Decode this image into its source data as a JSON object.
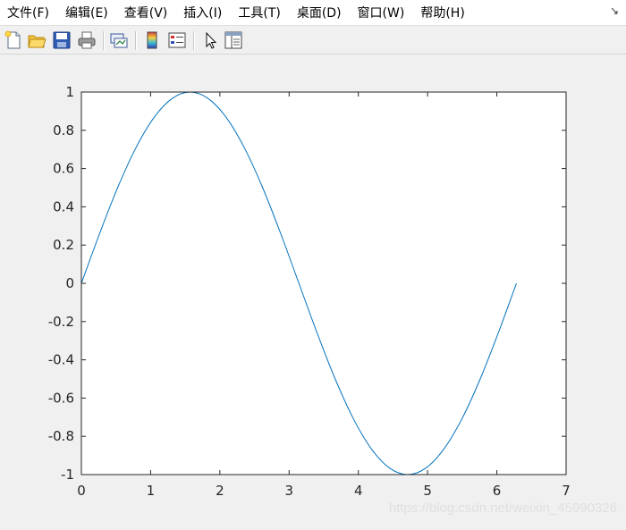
{
  "menu": {
    "items": [
      {
        "label": "文件(F)"
      },
      {
        "label": "编辑(E)"
      },
      {
        "label": "查看(V)"
      },
      {
        "label": "插入(I)"
      },
      {
        "label": "工具(T)"
      },
      {
        "label": "桌面(D)"
      },
      {
        "label": "窗口(W)"
      },
      {
        "label": "帮助(H)"
      }
    ],
    "dock_arrow": "↘"
  },
  "toolbar": {
    "buttons": [
      {
        "icon": "new-figure-icon"
      },
      {
        "icon": "open-file-icon"
      },
      {
        "icon": "save-icon"
      },
      {
        "icon": "print-icon"
      },
      {
        "icon": "link-plot-icon"
      },
      {
        "icon": "insert-colorbar-icon"
      },
      {
        "icon": "insert-legend-icon"
      },
      {
        "icon": "select-cursor-icon"
      },
      {
        "icon": "property-inspector-icon"
      }
    ]
  },
  "chart_data": {
    "type": "line",
    "title": "",
    "xlabel": "",
    "ylabel": "",
    "xlim": [
      0,
      7
    ],
    "ylim": [
      -1,
      1
    ],
    "x_ticks": [
      "0",
      "1",
      "2",
      "3",
      "4",
      "5",
      "6",
      "7"
    ],
    "y_ticks": [
      "1",
      "0.8",
      "0.6",
      "0.4",
      "0.2",
      "0",
      "-0.2",
      "-0.4",
      "-0.6",
      "-0.8",
      "-1"
    ],
    "grid": false,
    "series": [
      {
        "color": "#0072bd",
        "x": [
          0,
          0.2618,
          0.5236,
          0.7854,
          1.0472,
          1.309,
          1.5708,
          1.8326,
          2.0944,
          2.3562,
          2.618,
          2.8798,
          3.1416,
          3.4034,
          3.6652,
          3.927,
          4.1888,
          4.4506,
          4.7124,
          4.9742,
          5.236,
          5.4978,
          5.7596,
          6.0214,
          6.2832
        ],
        "y": [
          0,
          0.2588,
          0.5,
          0.7071,
          0.866,
          0.9659,
          1,
          0.9659,
          0.866,
          0.7071,
          0.5,
          0.2588,
          0,
          -0.2588,
          -0.5,
          -0.7071,
          -0.866,
          -0.9659,
          -1,
          -0.9659,
          -0.866,
          -0.7071,
          -0.5,
          -0.2588,
          0
        ]
      }
    ]
  },
  "watermark": "https://blog.csdn.net/weixin_45990326"
}
